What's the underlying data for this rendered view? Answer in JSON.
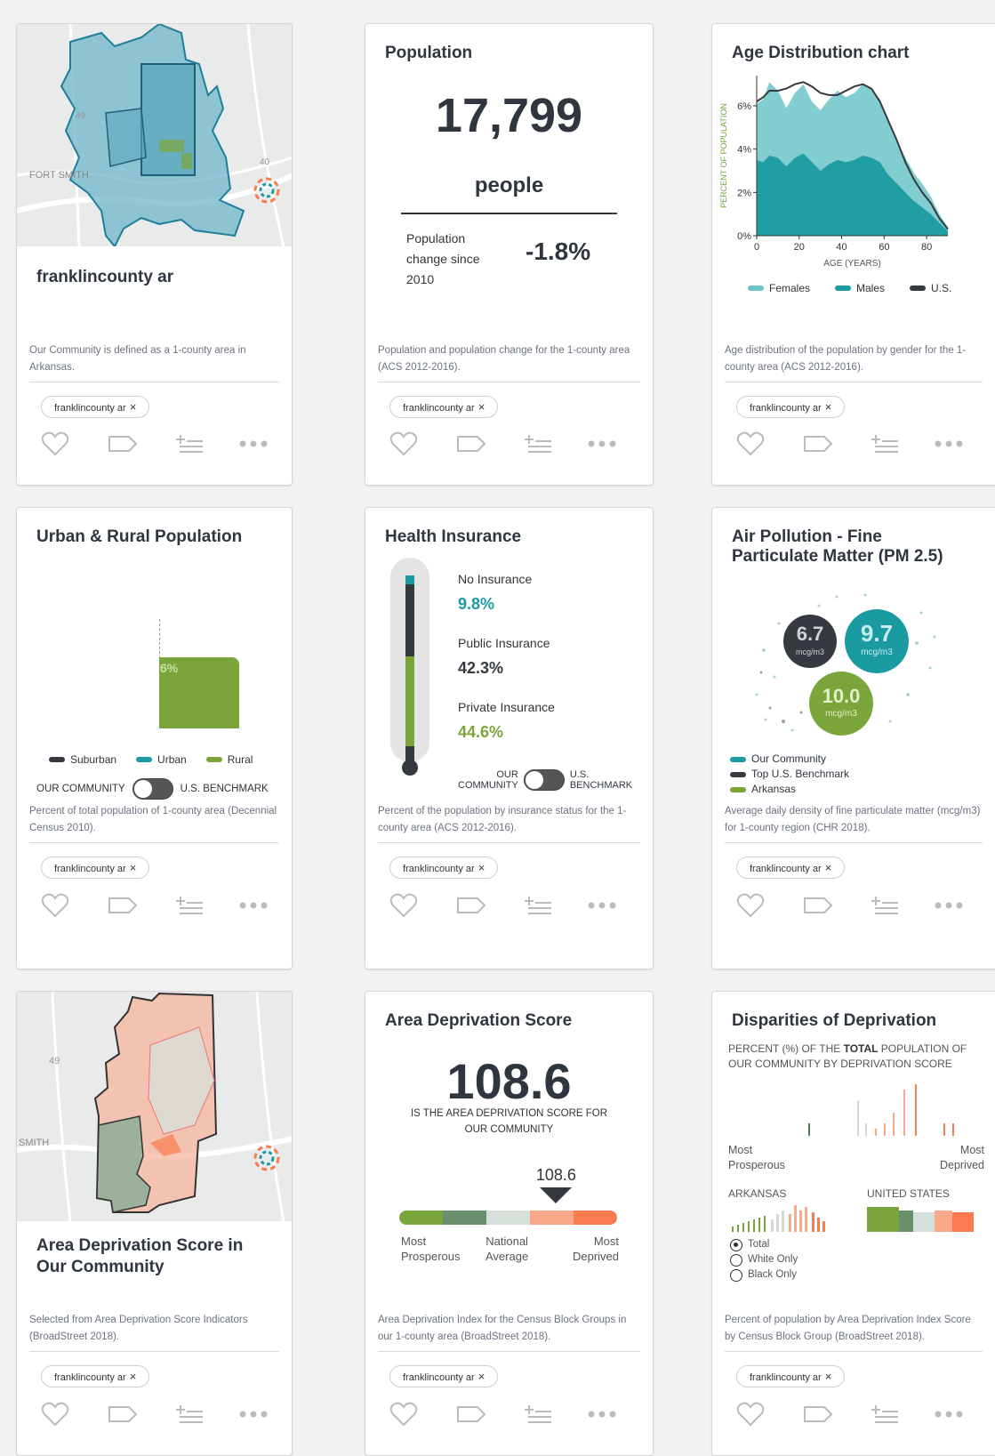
{
  "colors": {
    "teal": "#1a9ba1",
    "green": "#7aa53a",
    "dark": "#343a40",
    "orange": "#f97b4f",
    "lightteal": "#6cc4c8"
  },
  "common": {
    "tag": "franklincounty ar",
    "tag_close": "×"
  },
  "card_map1": {
    "map_labels": {
      "fort_smith": "FORT SMITH",
      "hwy49": "49",
      "hwy40": "40"
    },
    "title": "franklincounty ar",
    "desc": "Our Community is defined as a 1-county area in Arkansas."
  },
  "card_population": {
    "title": "Population",
    "value": "17,799",
    "unit": "people",
    "change_label_1": "Population",
    "change_label_2": "change since",
    "change_label_3": "2010",
    "change_value": "-1.8%",
    "desc": "Population and population change for the 1-county area (ACS 2012-2016)."
  },
  "card_age": {
    "title": "Age Distribution chart",
    "ylabel": "PERCENT OF POPULATION",
    "xlabel": "AGE (YEARS)",
    "legend": {
      "females": "Females",
      "males": "Males",
      "us": "U.S."
    },
    "desc": "Age distribution of the population by gender for the 1-county area (ACS 2012-2016)."
  },
  "chart_data": {
    "type": "area",
    "title": "Age Distribution chart",
    "xlabel": "AGE (YEARS)",
    "ylabel": "PERCENT OF POPULATION",
    "x_ticks": [
      "0",
      "20",
      "40",
      "60",
      "80"
    ],
    "y_ticks": [
      "0%",
      "2%",
      "4%",
      "6%"
    ],
    "xlim": [
      0,
      90
    ],
    "ylim": [
      0,
      7.4
    ],
    "x": [
      0,
      3,
      6,
      10,
      14,
      18,
      22,
      26,
      30,
      34,
      38,
      42,
      46,
      50,
      54,
      58,
      62,
      66,
      70,
      74,
      78,
      82,
      86,
      90
    ],
    "series": [
      {
        "name": "Females",
        "values": [
          6.1,
          6.3,
          7.1,
          6.7,
          5.9,
          6.6,
          7.0,
          6.2,
          5.8,
          6.3,
          6.7,
          6.4,
          6.6,
          7.0,
          6.8,
          6.3,
          5.2,
          4.4,
          3.6,
          2.9,
          2.4,
          1.8,
          1.0,
          0.4
        ]
      },
      {
        "name": "Males",
        "values": [
          3.5,
          3.4,
          3.7,
          3.6,
          3.2,
          3.6,
          3.8,
          3.4,
          3.0,
          3.3,
          3.5,
          3.4,
          3.5,
          3.7,
          3.6,
          3.4,
          2.8,
          2.4,
          2.0,
          1.6,
          1.3,
          1.0,
          0.6,
          0.2
        ]
      },
      {
        "name": "U.S.",
        "values": [
          6.2,
          6.4,
          6.7,
          6.7,
          6.8,
          7.0,
          7.1,
          6.9,
          6.6,
          6.5,
          6.5,
          6.7,
          6.9,
          7.0,
          6.8,
          6.2,
          5.3,
          4.4,
          3.4,
          2.6,
          2.0,
          1.5,
          0.8,
          0.3
        ]
      }
    ]
  },
  "card_urban": {
    "title": "Urban & Rural Population",
    "bar_label": "6%",
    "legend": {
      "suburban": "Suburban",
      "urban": "Urban",
      "rural": "Rural"
    },
    "toggle_left": "OUR COMMUNITY",
    "toggle_right": "U.S. BENCHMARK",
    "desc": "Percent of total population of 1-county area (Decennial Census 2010)."
  },
  "card_health": {
    "title": "Health Insurance",
    "no_ins_label": "No Insurance",
    "no_ins_value": "9.8%",
    "public_label": "Public Insurance",
    "public_value": "42.3%",
    "private_label": "Private Insurance",
    "private_value": "44.6%",
    "toggle_left_1": "OUR",
    "toggle_left_2": "COMMUNITY",
    "toggle_right_1": "U.S.",
    "toggle_right_2": "BENCHMARK",
    "desc": "Percent of the population by insurance status for the 1-county area (ACS 2012-2016)."
  },
  "card_air": {
    "title_1": "Air Pollution - Fine",
    "title_2": "Particulate Matter (PM 2.5)",
    "bubble_dark_value": "6.7",
    "bubble_teal_value": "9.7",
    "bubble_green_value": "10.0",
    "unit": "mcg/m3",
    "legend": {
      "community": "Our Community",
      "top_us": "Top U.S. Benchmark",
      "arkansas": "Arkansas"
    },
    "desc": "Average daily density of fine particulate matter (mcg/m3) for 1-county region (CHR 2018)."
  },
  "card_map2": {
    "map_labels": {
      "smith": "SMITH",
      "hwy49": "49"
    },
    "title_1": "Area Deprivation Score in",
    "title_2": "Our Community",
    "desc": "Selected from Area Deprivation Score Indicators (BroadStreet 2018)."
  },
  "card_ads": {
    "title": "Area Deprivation Score",
    "value": "108.6",
    "sub_1": "IS THE AREA DEPRIVATION SCORE FOR",
    "sub_2": "OUR COMMUNITY",
    "marker_value": "108.6",
    "marker_position": 0.72,
    "scale_left_1": "Most",
    "scale_left_2": "Prosperous",
    "scale_mid_1": "National",
    "scale_mid_2": "Average",
    "scale_right_1": "Most",
    "scale_right_2": "Deprived",
    "desc": "Area Deprivation Index for the Census Block Groups in our 1-county area (BroadStreet 2018)."
  },
  "card_disparities": {
    "title": "Disparities of Deprivation",
    "sub_pre": "PERCENT (%) OF THE ",
    "sub_bold": "TOTAL",
    "sub_post": " POPULATION OF",
    "sub_2": "OUR COMMUNITY BY DEPRIVATION SCORE",
    "left_1": "Most",
    "left_2": "Prosperous",
    "right_1": "Most",
    "right_2": "Deprived",
    "arkansas": "ARKANSAS",
    "united_states": "UNITED STATES",
    "radio_total": "Total",
    "radio_white": "White Only",
    "radio_black": "Black Only",
    "desc": "Percent of population by Area Deprivation Index Score by Census Block Group (BroadStreet 2018)."
  }
}
